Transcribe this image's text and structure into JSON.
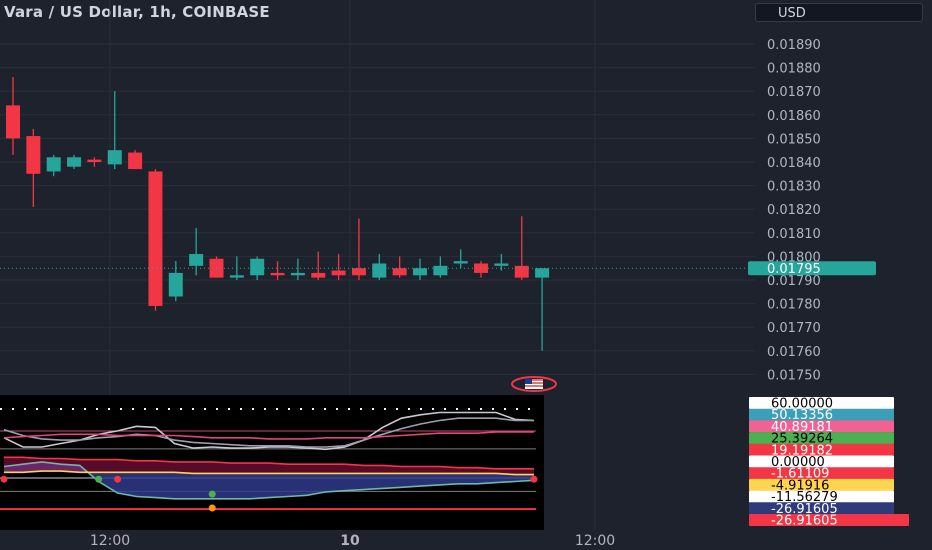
{
  "header": {
    "title": "Vara / US Dollar, 1h, COINBASE",
    "currency": "USD"
  },
  "colors": {
    "background": "#1e222d",
    "up": "#26a69a",
    "down": "#f23645",
    "indicator_panel": "#000000",
    "last_price_label": "#26a69a"
  },
  "chart_data": [
    {
      "type": "candlestick",
      "title": "Vara / US Dollar, 1h, COINBASE",
      "y_ticks": [
        "0.01890",
        "0.01880",
        "0.01870",
        "0.01860",
        "0.01850",
        "0.01840",
        "0.01830",
        "0.01820",
        "0.01810",
        "0.01800",
        "0.01790",
        "0.01780",
        "0.01770",
        "0.01760",
        "0.01750"
      ],
      "x_ticks": [
        "12:00",
        "10",
        "12:00"
      ],
      "last_price": "0.01795",
      "ylim": [
        0.01745,
        0.01905
      ],
      "candles": [
        {
          "o": 0.01864,
          "h": 0.01876,
          "l": 0.01843,
          "c": 0.0185
        },
        {
          "o": 0.01851,
          "h": 0.01854,
          "l": 0.01821,
          "c": 0.01835
        },
        {
          "o": 0.01836,
          "h": 0.01843,
          "l": 0.01834,
          "c": 0.01842
        },
        {
          "o": 0.01838,
          "h": 0.01843,
          "l": 0.01837,
          "c": 0.01842
        },
        {
          "o": 0.01841,
          "h": 0.01842,
          "l": 0.01838,
          "c": 0.0184
        },
        {
          "o": 0.01839,
          "h": 0.0187,
          "l": 0.01837,
          "c": 0.01845
        },
        {
          "o": 0.01844,
          "h": 0.01845,
          "l": 0.01837,
          "c": 0.01837
        },
        {
          "o": 0.01836,
          "h": 0.01837,
          "l": 0.01777,
          "c": 0.01779
        },
        {
          "o": 0.01783,
          "h": 0.01798,
          "l": 0.01781,
          "c": 0.01793
        },
        {
          "o": 0.01796,
          "h": 0.01812,
          "l": 0.01792,
          "c": 0.01801
        },
        {
          "o": 0.01799,
          "h": 0.018,
          "l": 0.01791,
          "c": 0.01791
        },
        {
          "o": 0.01791,
          "h": 0.018,
          "l": 0.0179,
          "c": 0.01792
        },
        {
          "o": 0.01792,
          "h": 0.018,
          "l": 0.0179,
          "c": 0.01799
        },
        {
          "o": 0.01793,
          "h": 0.01798,
          "l": 0.0179,
          "c": 0.01792
        },
        {
          "o": 0.01792,
          "h": 0.01799,
          "l": 0.0179,
          "c": 0.01793
        },
        {
          "o": 0.01793,
          "h": 0.01802,
          "l": 0.0179,
          "c": 0.01791
        },
        {
          "o": 0.01794,
          "h": 0.01801,
          "l": 0.0179,
          "c": 0.01792
        },
        {
          "o": 0.01795,
          "h": 0.01816,
          "l": 0.0179,
          "c": 0.01792
        },
        {
          "o": 0.01791,
          "h": 0.01801,
          "l": 0.0179,
          "c": 0.01797
        },
        {
          "o": 0.01795,
          "h": 0.018,
          "l": 0.01791,
          "c": 0.01792
        },
        {
          "o": 0.01792,
          "h": 0.01799,
          "l": 0.0179,
          "c": 0.01795
        },
        {
          "o": 0.01792,
          "h": 0.018,
          "l": 0.01791,
          "c": 0.01796
        },
        {
          "o": 0.01797,
          "h": 0.01803,
          "l": 0.01795,
          "c": 0.01798
        },
        {
          "o": 0.01797,
          "h": 0.01798,
          "l": 0.01791,
          "c": 0.01793
        },
        {
          "o": 0.01796,
          "h": 0.01801,
          "l": 0.01794,
          "c": 0.01797
        },
        {
          "o": 0.01796,
          "h": 0.01817,
          "l": 0.0179,
          "c": 0.01791
        },
        {
          "o": 0.01791,
          "h": 0.01795,
          "l": 0.0176,
          "c": 0.01795
        }
      ]
    },
    {
      "type": "line",
      "name": "indicator",
      "value_labels": [
        "60.00000",
        "50.13356",
        "40.89181",
        "25.39264",
        "19.19182",
        "0.00000",
        "-1.61109",
        "-4.91916",
        "-11.56279",
        "-26.91605",
        "-26.91605"
      ],
      "value_label_colors": [
        "#ffffff",
        "#3c9fb8",
        "#f06292",
        "#4caf50",
        "#f23645",
        "#ffffff",
        "#f23645",
        "#ffd54f",
        "#ffffff",
        "#2f3a7a",
        "#f23645"
      ],
      "value_label_text_colors": [
        "#000000",
        "#ffffff",
        "#ffffff",
        "#000000",
        "#ffffff",
        "#000000",
        "#ffffff",
        "#000000",
        "#000000",
        "#ffffff",
        "#ffffff"
      ],
      "ylim": [
        -33,
        66
      ],
      "levels": [
        60,
        40.89,
        25.39,
        0,
        -11.56
      ],
      "level_colors": [
        "#ffffff",
        "#f06292",
        "#9e9e9e",
        "#ffffff",
        "#9e9e9e"
      ],
      "level_dashed": [
        true,
        false,
        false,
        false,
        false
      ],
      "series": [
        {
          "values": [
            35,
            27,
            27,
            30,
            33,
            38,
            41,
            45,
            44,
            30,
            26,
            27,
            26,
            26,
            27,
            27,
            26,
            25,
            27,
            33,
            44,
            52,
            55,
            57,
            57,
            57,
            57,
            51,
            50
          ],
          "color": "#c9c9d1"
        },
        {
          "values": [
            42,
            37,
            34,
            33,
            33,
            35,
            36,
            38,
            37,
            33,
            31,
            30,
            29,
            28,
            28,
            28,
            27,
            27,
            28,
            33,
            38,
            43,
            47,
            50,
            52,
            52,
            52,
            50,
            50
          ],
          "color": "#9c9fb0"
        },
        {
          "values": [
            35,
            36,
            37,
            38,
            38,
            38,
            37,
            37,
            37,
            37,
            36,
            35,
            35,
            35,
            34,
            34,
            34,
            35,
            35,
            35,
            36,
            37,
            38,
            39,
            39,
            39,
            40,
            40,
            40
          ],
          "color": "#e0457b"
        },
        {
          "values": [
            10,
            12,
            14,
            12,
            11,
            -3,
            -13,
            -16,
            -17,
            -18,
            -18,
            -18,
            -18,
            -18,
            -17,
            -16,
            -15,
            -12,
            -11,
            -10,
            -9,
            -8,
            -7,
            -6,
            -5,
            -5,
            -4,
            -3,
            -2
          ],
          "color": "#6fb7a8"
        },
        {
          "values": [
            18,
            18,
            17,
            17,
            16,
            16,
            16,
            15,
            15,
            14,
            14,
            14,
            13,
            13,
            13,
            12,
            12,
            12,
            12,
            11,
            11,
            10,
            10,
            10,
            9,
            9,
            8,
            8,
            8
          ],
          "color": "#f23645"
        },
        {
          "values": [
            5,
            5,
            6,
            6,
            5,
            5,
            5,
            5,
            5,
            5,
            4,
            4,
            4,
            4,
            4,
            4,
            4,
            4,
            4,
            4,
            4,
            4,
            4,
            4,
            4,
            4,
            4,
            3,
            3
          ],
          "color": "#ffd54f"
        }
      ],
      "markers": [
        {
          "i": 0,
          "v": -1,
          "color": "#f23645"
        },
        {
          "i": 5,
          "v": -1,
          "color": "#4caf50"
        },
        {
          "i": 6,
          "v": -1,
          "color": "#f23645"
        },
        {
          "i": 11,
          "v": -14,
          "color": "#4caf50"
        },
        {
          "i": 28,
          "v": -1,
          "color": "#f23645"
        },
        {
          "i": 11,
          "v": -26,
          "color": "#ff9800"
        }
      ]
    }
  ]
}
